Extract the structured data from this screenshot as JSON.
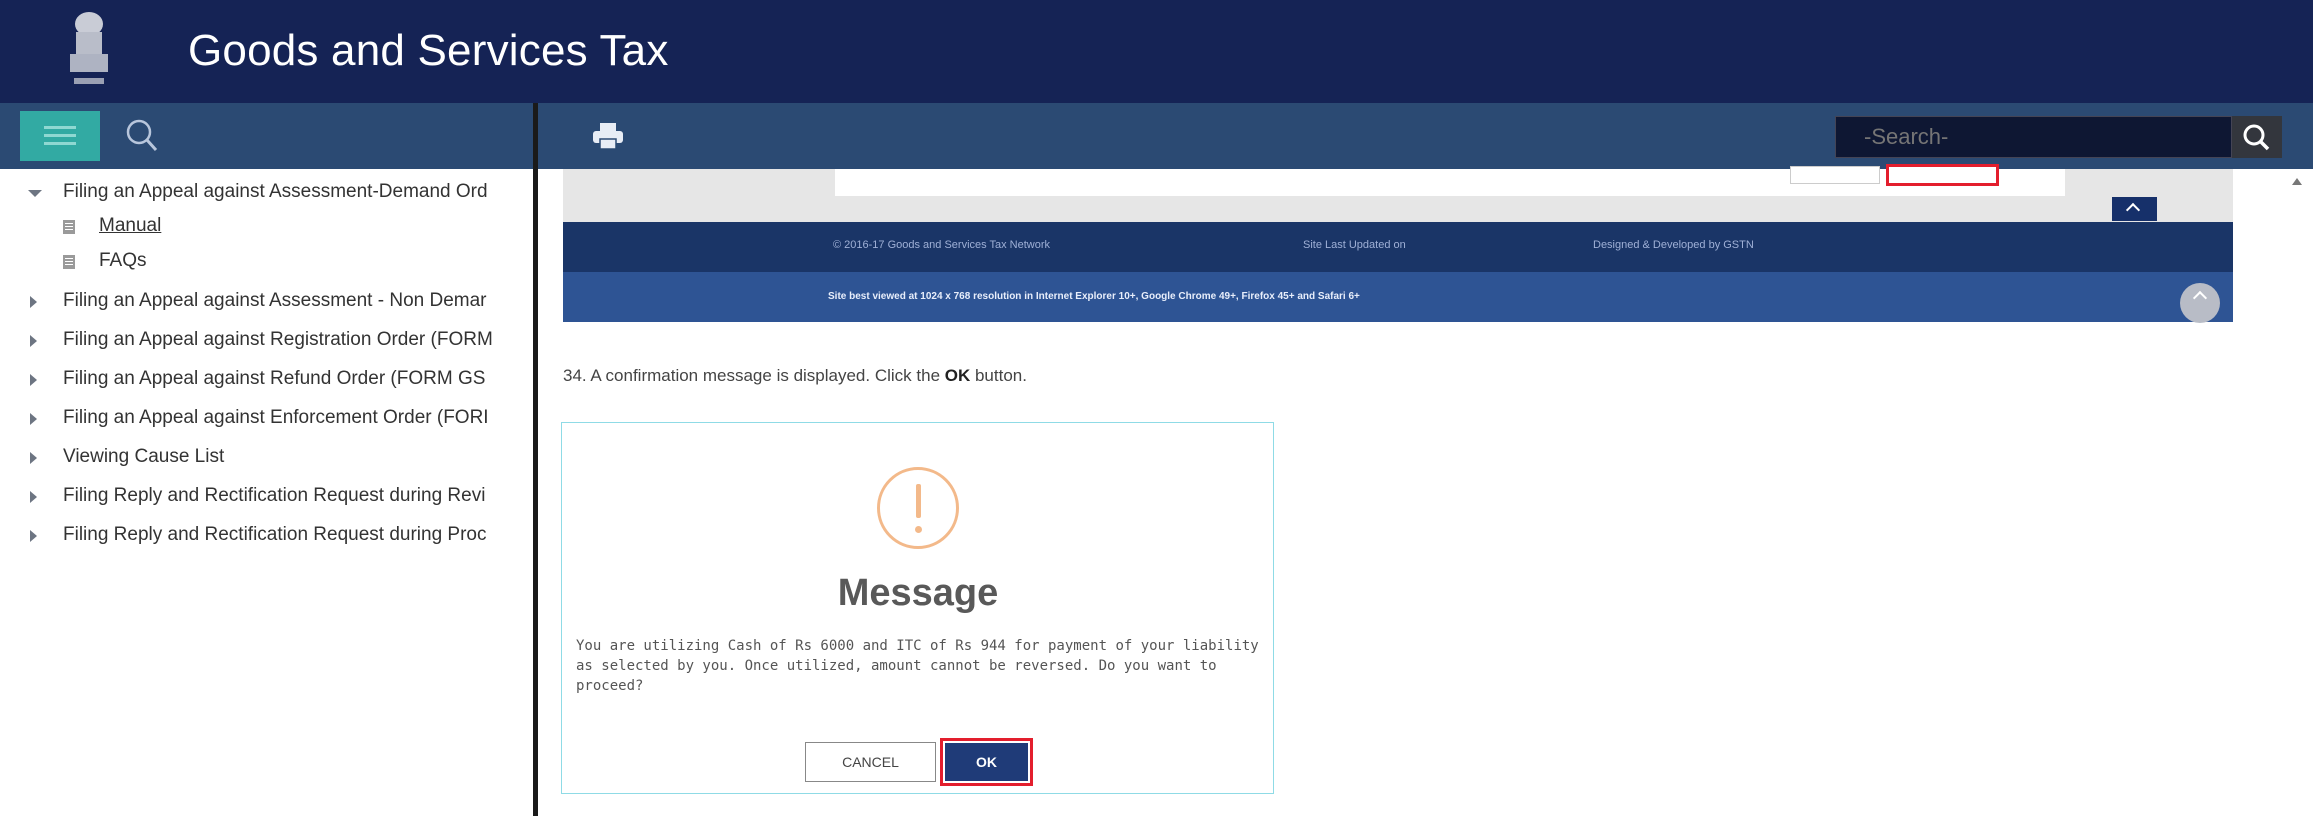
{
  "header": {
    "title": "Goods and Services Tax"
  },
  "search": {
    "placeholder": "-Search-"
  },
  "sidebar": {
    "items": [
      {
        "label": "Filing an Appeal against Assessment-Demand Ord",
        "expanded": true,
        "children": [
          {
            "label": "Manual"
          },
          {
            "label": "FAQs"
          }
        ]
      },
      {
        "label": "Filing an Appeal against Assessment - Non Demar"
      },
      {
        "label": "Filing an Appeal against Registration Order (FORM"
      },
      {
        "label": "Filing an Appeal against Refund Order (FORM GS"
      },
      {
        "label": "Filing an Appeal against Enforcement Order (FORI"
      },
      {
        "label": "Viewing Cause List"
      },
      {
        "label": "Filing Reply and Rectification Request during Revi"
      },
      {
        "label": "Filing Reply and Rectification Request during Proc"
      }
    ],
    "collapse_glyph": "«"
  },
  "content": {
    "footer_shot": {
      "copyright": "© 2016-17 Goods and Services Tax Network",
      "last_updated": "Site Last Updated on",
      "designed_by": "Designed & Developed by GSTN",
      "best_viewed": "Site best viewed at 1024 x 768 resolution in Internet Explorer 10+, Google Chrome 49+, Firefox 45+ and Safari 6+",
      "top_label": "Top"
    },
    "instruction": {
      "prefix": "34. A confirmation message is displayed. Click the ",
      "bold": "OK",
      "suffix": " button."
    },
    "dialog": {
      "title": "Message",
      "body": "You are utilizing Cash of Rs 6000 and ITC of Rs 944 for payment of your liability as selected by you. Once utilized, amount cannot be reversed. Do you want to proceed?",
      "cancel_label": "CANCEL",
      "ok_label": "OK"
    }
  },
  "colors": {
    "header_bg": "#152355",
    "toolbar_bg": "#2b4a73",
    "menu_toggle_bg": "#32aaa3",
    "highlight_red": "#e31e2d",
    "ok_button_bg": "#1f3b78"
  },
  "icons": [
    "emblem-icon",
    "hamburger-icon",
    "search-icon",
    "print-icon",
    "search-submit-icon",
    "collapse-icon",
    "alert-icon",
    "chevron-up-icon"
  ]
}
